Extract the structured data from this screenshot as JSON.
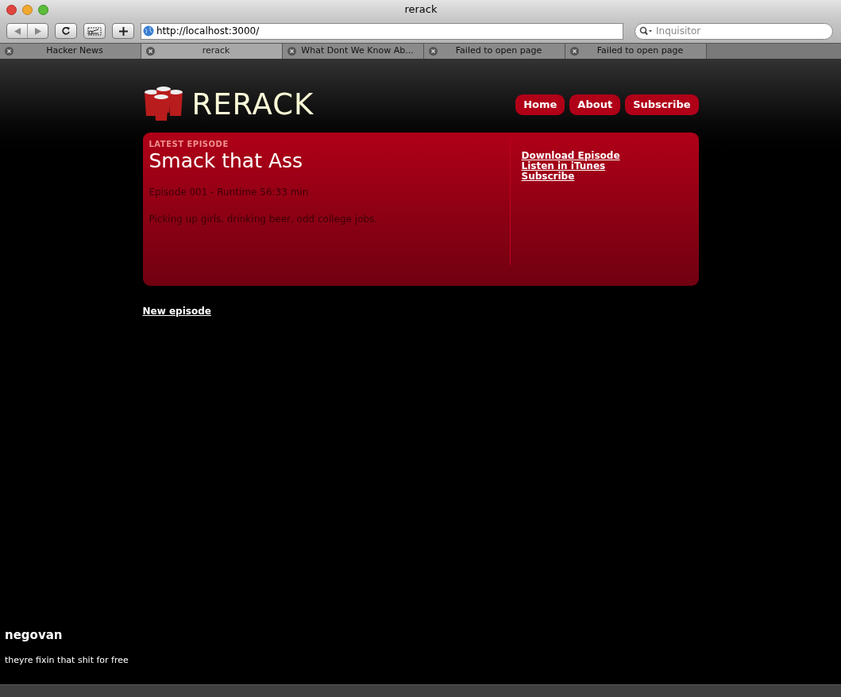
{
  "window": {
    "title": "rerack"
  },
  "toolbar": {
    "address": "http://localhost:3000/",
    "search": {
      "placeholder": "Inquisitor"
    }
  },
  "tabs": [
    {
      "label": "Hacker News",
      "selected": false
    },
    {
      "label": "rerack",
      "selected": true
    },
    {
      "label": "What Dont We Know Ab...",
      "selected": false
    },
    {
      "label": "Failed to open page",
      "selected": false
    },
    {
      "label": "Failed to open page",
      "selected": false
    }
  ],
  "site": {
    "logo": "RERACK",
    "nav": [
      "Home",
      "About",
      "Subscribe"
    ]
  },
  "episode": {
    "eyebrow": "LATEST EPISODE",
    "title": "Smack that Ass",
    "meta": "Episode 001 - Runtime 56:33 min",
    "description": "Picking up girls, drinking beer, odd college jobs.",
    "links": [
      "Download Episode",
      "Listen in iTunes",
      "Subscribe"
    ]
  },
  "new_episode_link": "New episode",
  "comment": {
    "author": "negovan",
    "text": "theyre fixin that shit for free"
  }
}
